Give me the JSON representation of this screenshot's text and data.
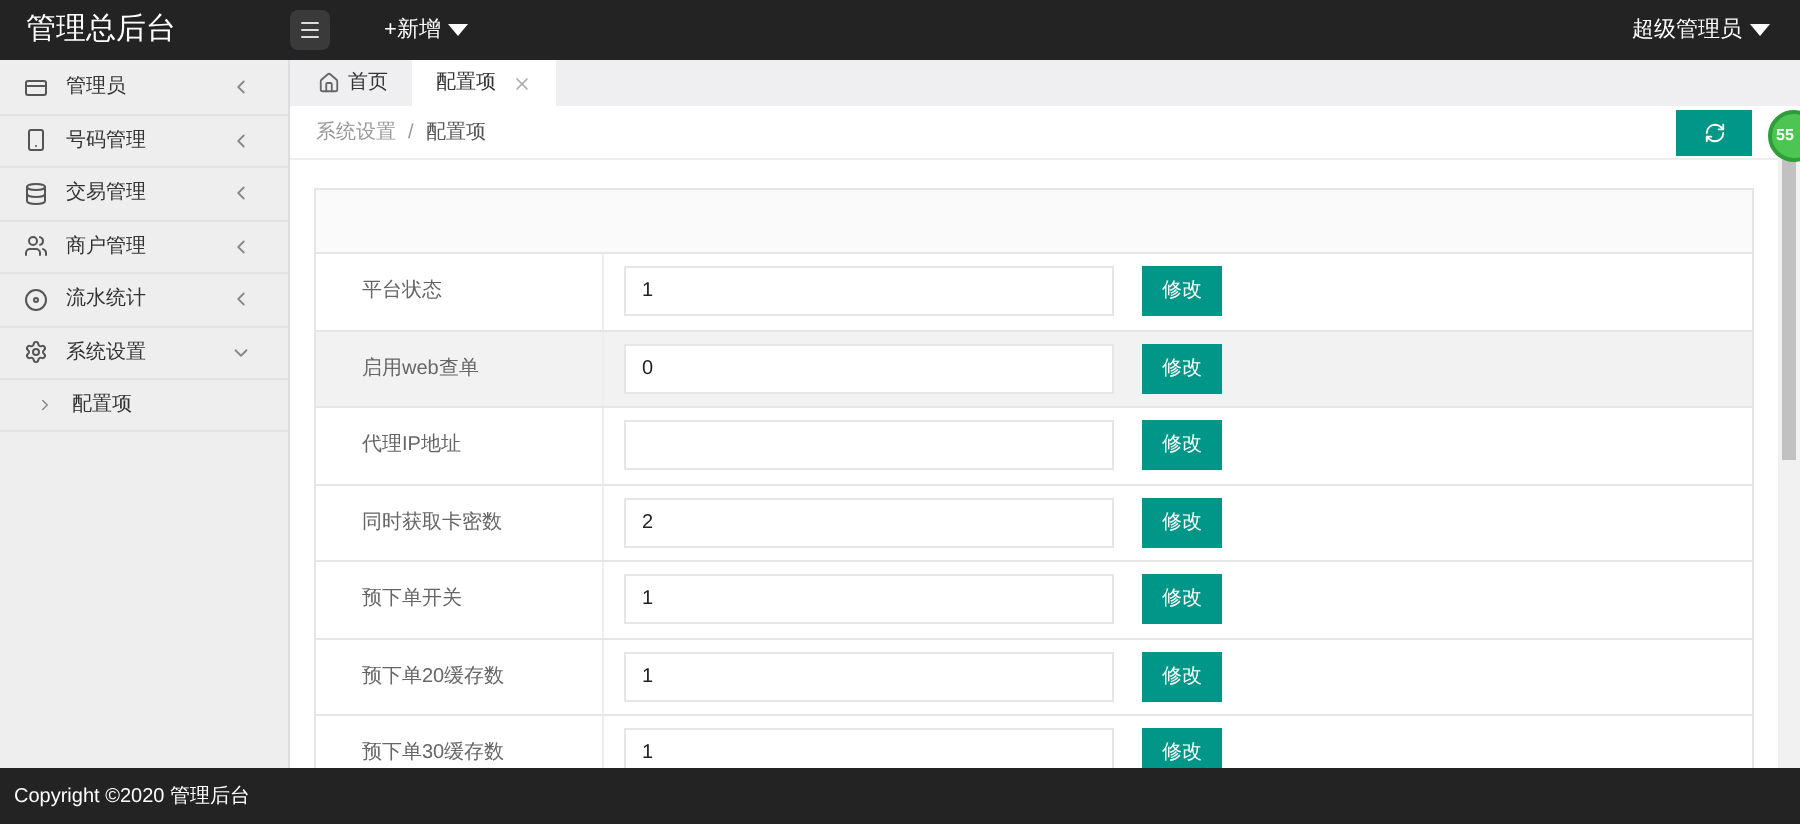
{
  "header": {
    "title": "管理总后台",
    "new_menu": "+新增",
    "user_menu": "超级管理员"
  },
  "sidebar": {
    "items": [
      {
        "label": "管理员",
        "expanded": false
      },
      {
        "label": "号码管理",
        "expanded": false
      },
      {
        "label": "交易管理",
        "expanded": false
      },
      {
        "label": "商户管理",
        "expanded": false
      },
      {
        "label": "流水统计",
        "expanded": false
      },
      {
        "label": "系统设置",
        "expanded": true,
        "children": [
          {
            "label": "配置项"
          }
        ]
      }
    ]
  },
  "tabs": [
    {
      "label": "首页",
      "kind": "home",
      "selected": false
    },
    {
      "label": "配置项",
      "kind": "closable",
      "selected": true
    }
  ],
  "breadcrumb": {
    "items": [
      "系统设置",
      "配置项"
    ],
    "separator": "/"
  },
  "float_badge": "55",
  "settings": {
    "rows": [
      {
        "label": "平台状态",
        "value": "1",
        "hovered": false,
        "button": "修改"
      },
      {
        "label": "启用web查单",
        "value": "0",
        "hovered": true,
        "button": "修改"
      },
      {
        "label": "代理IP地址",
        "value": "",
        "hovered": false,
        "button": "修改"
      },
      {
        "label": "同时获取卡密数",
        "value": "2",
        "hovered": false,
        "button": "修改"
      },
      {
        "label": "预下单开关",
        "value": "1",
        "hovered": false,
        "button": "修改"
      },
      {
        "label": "预下单20缓存数",
        "value": "1",
        "hovered": false,
        "button": "修改"
      },
      {
        "label": "预下单30缓存数",
        "value": "1",
        "hovered": false,
        "button": "修改"
      }
    ]
  },
  "footer": "Copyright ©2020 管理后台"
}
